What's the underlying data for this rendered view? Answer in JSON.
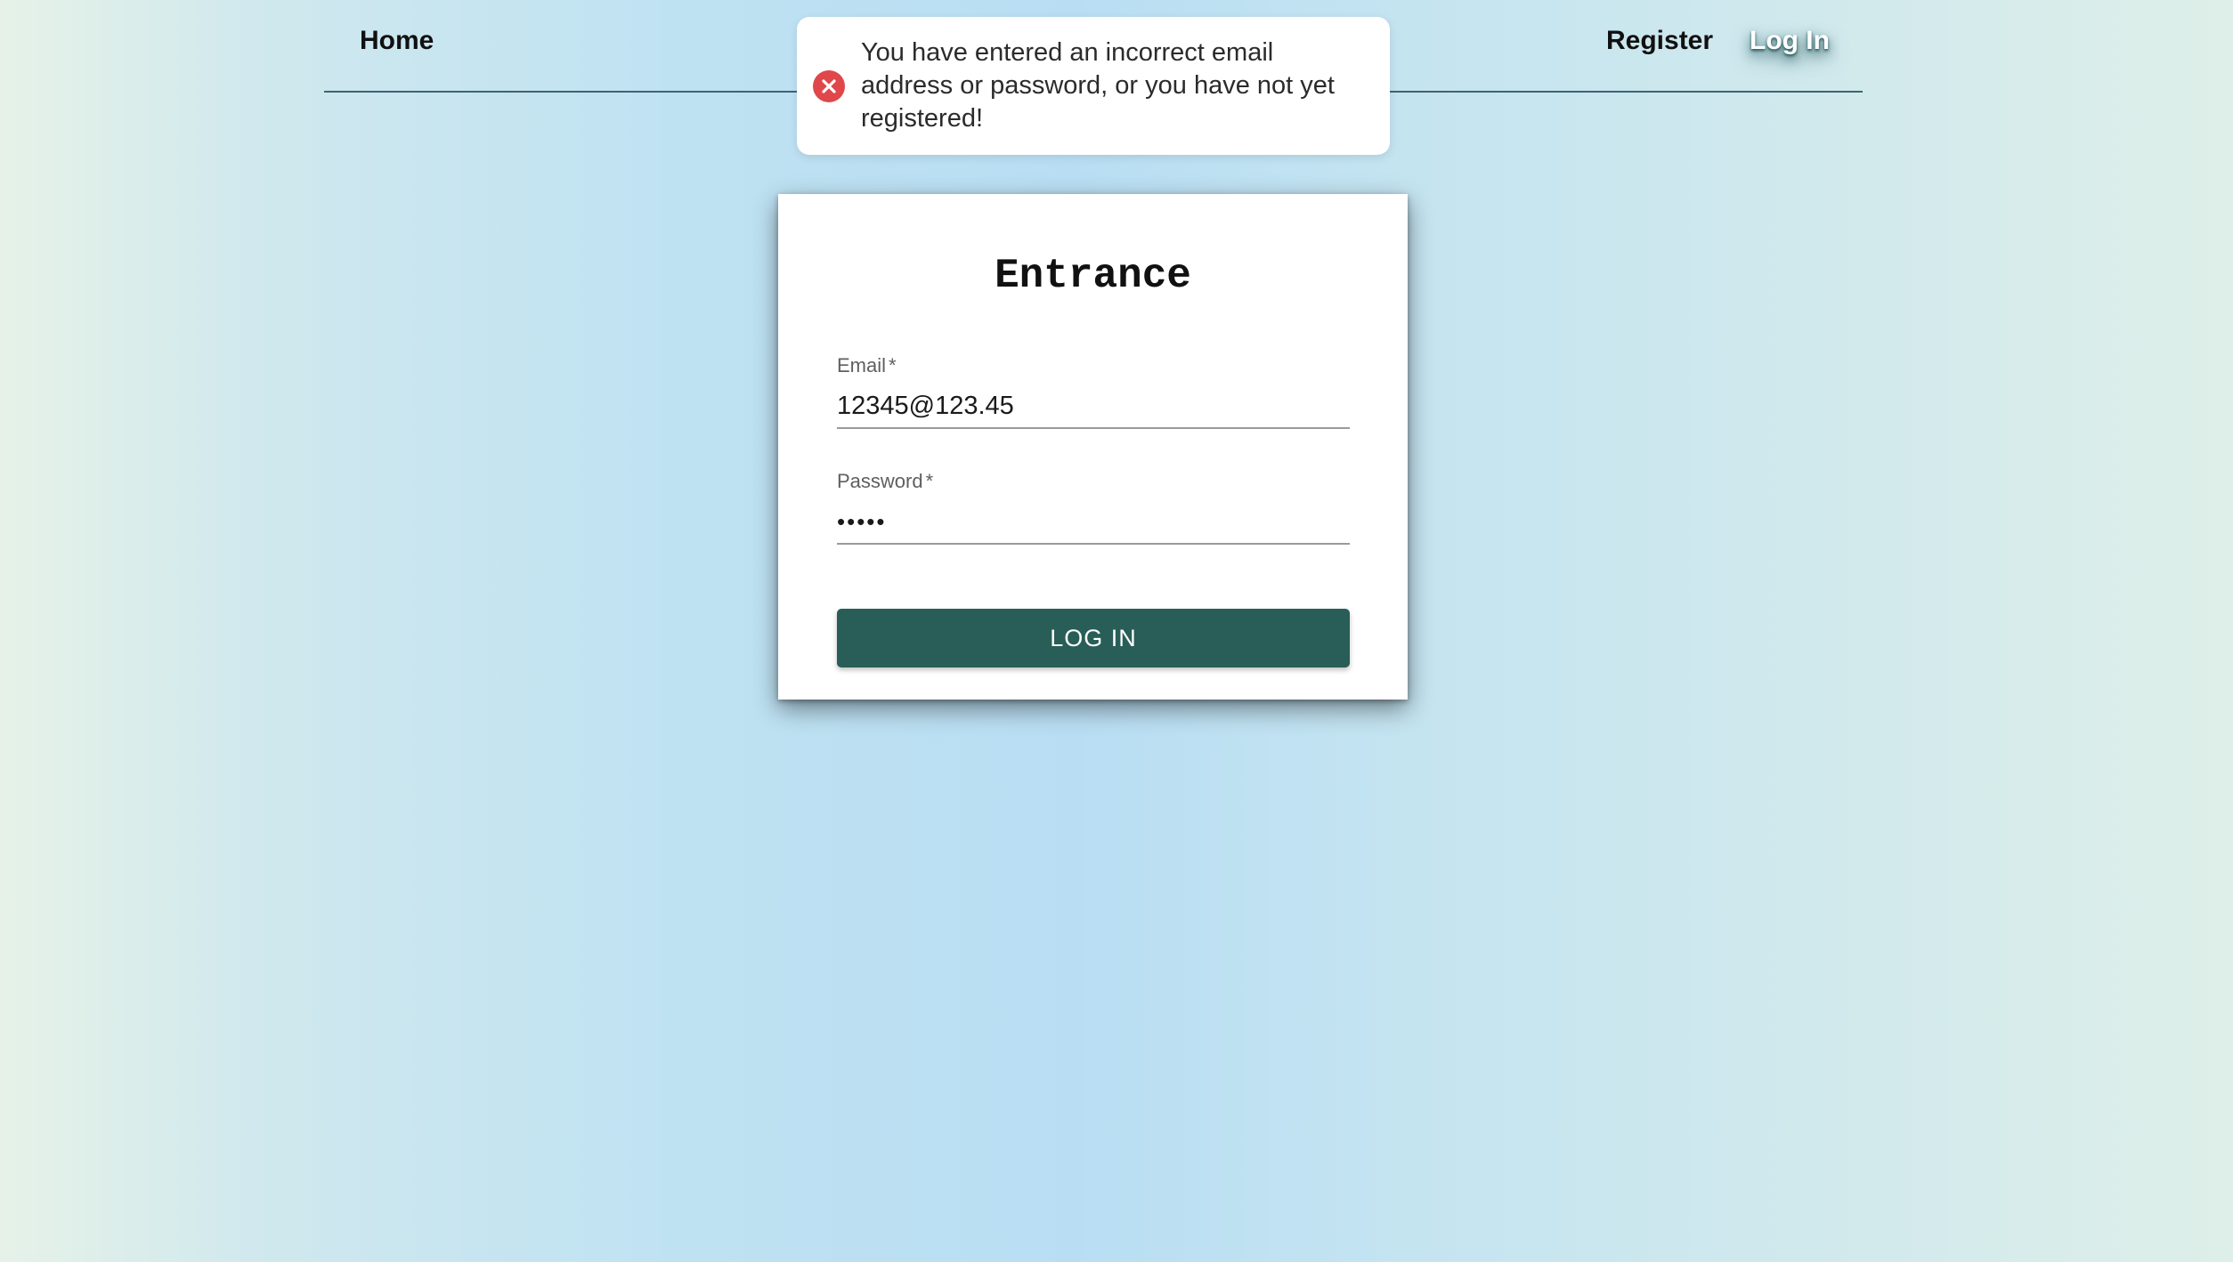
{
  "nav": {
    "home_label": "Home",
    "register_label": "Register",
    "login_label": "Log In"
  },
  "toast": {
    "type": "error",
    "icon": "close-circle-icon",
    "message": "You have entered an incorrect email address or password, or you have not yet registered!"
  },
  "login_form": {
    "title": "Entrance",
    "email": {
      "label": "Email",
      "required_marker": "*",
      "value": "12345@123.45"
    },
    "password": {
      "label": "Password",
      "required_marker": "*",
      "masked_value": "•••••"
    },
    "submit_label": "LOG IN"
  },
  "colors": {
    "button": "#285e57",
    "error": "#e0474a",
    "nav_divider": "#3f6470"
  }
}
